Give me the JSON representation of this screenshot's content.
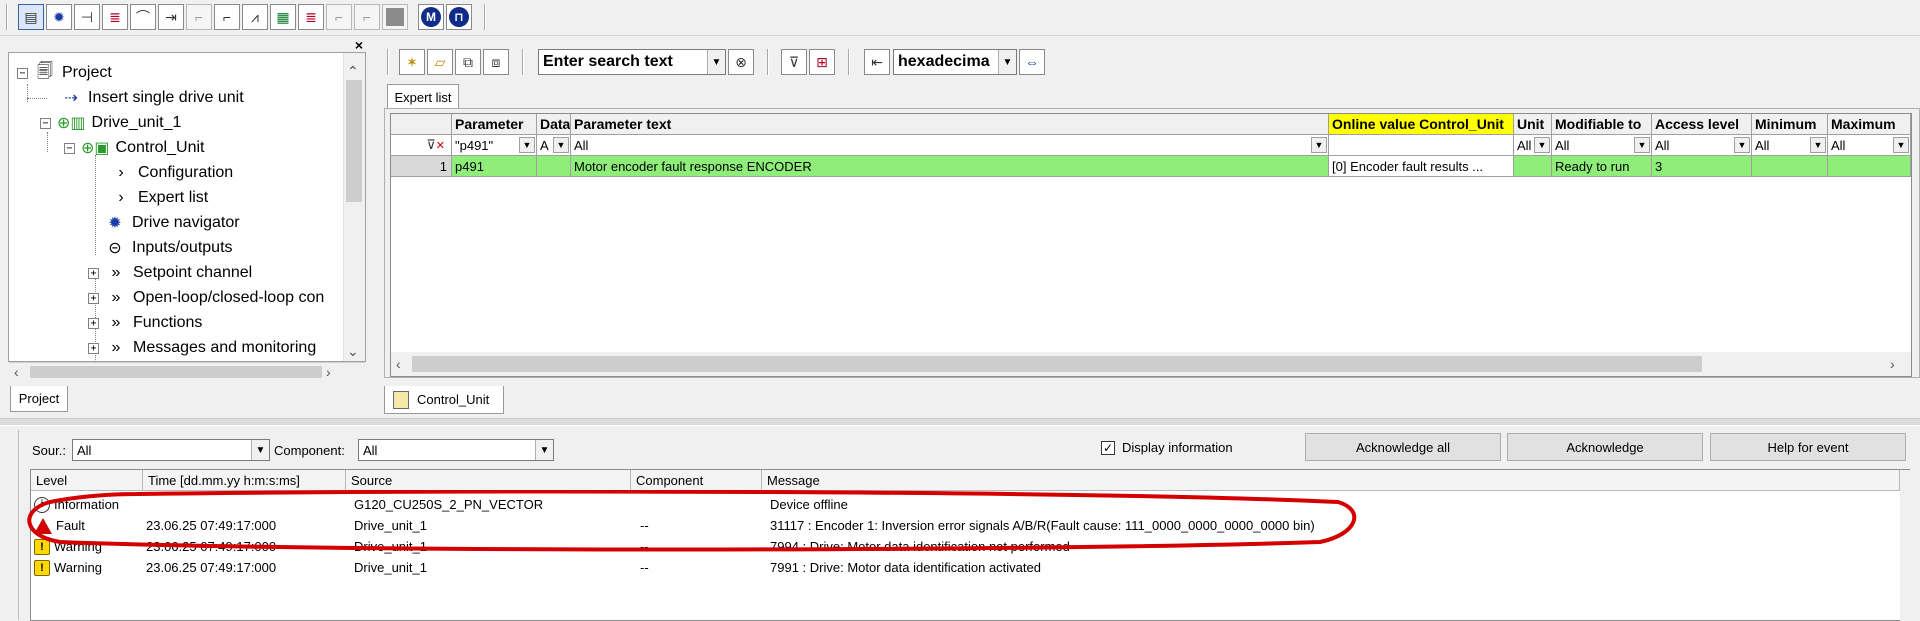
{
  "project_panel": {
    "close_glyph": "×",
    "tab_label": "Project",
    "tree": [
      {
        "label": "Project",
        "expander": "−"
      },
      {
        "label": "Insert single drive unit"
      },
      {
        "label": "Drive_unit_1",
        "expander": "−"
      },
      {
        "label": "Control_Unit",
        "expander": "−"
      },
      {
        "label": "Configuration"
      },
      {
        "label": "Expert list"
      },
      {
        "label": "Drive navigator"
      },
      {
        "label": "Inputs/outputs"
      },
      {
        "label": "Setpoint channel",
        "expander": "+"
      },
      {
        "label": "Open-loop/closed-loop con",
        "expander": "+"
      },
      {
        "label": "Functions",
        "expander": "+"
      },
      {
        "label": "Messages and monitoring",
        "expander": "+"
      }
    ]
  },
  "expert_toolbar": {
    "search_placeholder": "Enter search text",
    "number_format": "hexadecima"
  },
  "expert_list": {
    "tab_label": "Expert list",
    "columns": [
      "Parameter",
      "Data",
      "Parameter text",
      "Online value Control_Unit",
      "Unit",
      "Modifiable to",
      "Access level",
      "Minimum",
      "Maximum"
    ],
    "filters": [
      "\"p491\"",
      "A",
      "All",
      "",
      "All",
      "All",
      "All",
      "All",
      "All"
    ],
    "rows": [
      {
        "num": "1",
        "parameter": "p491",
        "data": "",
        "text": "Motor encoder fault response ENCODER",
        "online_value": "[0] Encoder fault results ...",
        "unit": "",
        "modifiable": "Ready to run",
        "access": "3",
        "minimum": "",
        "maximum": ""
      }
    ]
  },
  "bottom_tab": {
    "label": "Control_Unit"
  },
  "alarms": {
    "source_label": "Sour.:",
    "source_value": "All",
    "component_label": "Component:",
    "component_value": "All",
    "display_info_label": "Display information",
    "display_info_checked": true,
    "buttons": {
      "ack_all": "Acknowledge all",
      "ack": "Acknowledge",
      "help": "Help for event"
    },
    "columns": [
      "Level",
      "Time [dd.mm.yy  h:m:s:ms]",
      "Source",
      "Component",
      "Message"
    ],
    "rows": [
      {
        "level": "Information",
        "level_type": "info",
        "time": "",
        "source": "G120_CU250S_2_PN_VECTOR",
        "component": "",
        "message": "Device offline"
      },
      {
        "level": "Fault",
        "level_type": "fault",
        "time": "23.06.25   07:49:17:000",
        "source": "Drive_unit_1",
        "component": "--",
        "message": "31117 : Encoder 1: Inversion error signals A/B/R(Fault cause: 111_0000_0000_0000_0000 bin)"
      },
      {
        "level": "Warning",
        "level_type": "warning",
        "time": "23.06.25   07:49:17:000",
        "source": "Drive_unit_1",
        "component": "--",
        "message": "7994 : Drive: Motor data identification not performed"
      },
      {
        "level": "Warning",
        "level_type": "warning",
        "time": "23.06.25   07:49:17:000",
        "source": "Drive_unit_1",
        "component": "--",
        "message": "7991 : Drive: Motor data identification activated"
      }
    ]
  },
  "colors": {
    "row_highlight": "#8fee79",
    "online_header": "#ffff00",
    "annotation": "#d40000"
  }
}
